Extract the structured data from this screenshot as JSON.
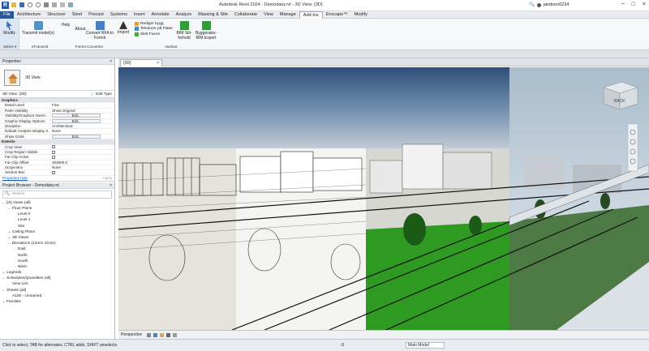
{
  "window": {
    "title": "Autodesk Revit 2024 - Demodata.rvt - 3D View: {3D}",
    "user": "jandson0234"
  },
  "menu": [
    "File",
    "Architecture",
    "Structure",
    "Steel",
    "Precast",
    "Systems",
    "Insert",
    "Annotate",
    "Analyze",
    "Massing & Site",
    "Collaborate",
    "View",
    "Manage",
    "Add-Ins",
    "Enscape™",
    "Modify"
  ],
  "ribbon": {
    "modify": "Modify",
    "select": "Select ▾",
    "transmit": "Transmit model(s)",
    "transmit_group": "eTransmit",
    "help": "Help",
    "about": "About",
    "convert": "Convert RFA to Formit",
    "formit_group": "FormIt Converter",
    "import": "Import",
    "rediger": "Rediger bygg",
    "teksturer": "Teksturer på Flater",
    "slett": "Slett Faces",
    "bim_forhold": "BIM Stil-forhold",
    "byggesaks": "Byggesaks-BIM Export",
    "norkart_group": "Norkart"
  },
  "properties": {
    "header": "Properties",
    "type_name": "3D View",
    "selector": "3D View: {3D}",
    "edit_type": "Edit Type",
    "rows": [
      {
        "k": "Graphics",
        "v": "",
        "cat": true
      },
      {
        "k": "Detail Level",
        "v": "Fine"
      },
      {
        "k": "Parts Visibility",
        "v": "Show Original"
      },
      {
        "k": "Visibility/Graphics Overri...",
        "v": "Edit...",
        "btn": true
      },
      {
        "k": "Graphic Display Options",
        "v": "Edit...",
        "btn": true
      },
      {
        "k": "Discipline",
        "v": "Architectural"
      },
      {
        "k": "Default Analysis Display S...",
        "v": "None"
      },
      {
        "k": "Show Grids",
        "v": "Edit...",
        "btn": true
      },
      {
        "k": "Extents",
        "v": "",
        "cat": true
      },
      {
        "k": "Crop View",
        "v": "",
        "cb": true
      },
      {
        "k": "Crop Region Visible",
        "v": "",
        "cb": true
      },
      {
        "k": "Far Clip Active",
        "v": "",
        "cb": true
      },
      {
        "k": "Far Clip Offset",
        "v": "304800.0"
      },
      {
        "k": "Scope Box",
        "v": "None"
      },
      {
        "k": "Section Box",
        "v": "",
        "cb": true
      }
    ],
    "help_link": "Properties help",
    "apply": "Apply"
  },
  "browser": {
    "header": "Project Browser - Demodata.rvt",
    "search": "Search",
    "items": [
      {
        "t": "[O] Views (all)",
        "lvl": 0,
        "tg": "−"
      },
      {
        "t": "Floor Plans",
        "lvl": 1,
        "tg": "−"
      },
      {
        "t": "Level 0",
        "lvl": 2,
        "tg": ""
      },
      {
        "t": "Level 1",
        "lvl": 2,
        "tg": ""
      },
      {
        "t": "Site",
        "lvl": 2,
        "tg": ""
      },
      {
        "t": "Ceiling Plans",
        "lvl": 1,
        "tg": "+"
      },
      {
        "t": "3D Views",
        "lvl": 1,
        "tg": "+"
      },
      {
        "t": "Elevations (12mm Circle)",
        "lvl": 1,
        "tg": "−"
      },
      {
        "t": "East",
        "lvl": 2,
        "tg": ""
      },
      {
        "t": "North",
        "lvl": 2,
        "tg": ""
      },
      {
        "t": "South",
        "lvl": 2,
        "tg": ""
      },
      {
        "t": "West",
        "lvl": 2,
        "tg": ""
      },
      {
        "t": "Legends",
        "lvl": 0,
        "tg": "+"
      },
      {
        "t": "Schedules/Quantities (all)",
        "lvl": 0,
        "tg": "−"
      },
      {
        "t": "View List",
        "lvl": 1,
        "tg": ""
      },
      {
        "t": "Sheets (all)",
        "lvl": 0,
        "tg": "−"
      },
      {
        "t": "A100 - Unnamed",
        "lvl": 1,
        "tg": ""
      },
      {
        "t": "Families",
        "lvl": 0,
        "tg": "+"
      }
    ]
  },
  "viewtab": "{3D}",
  "viewcube": "BACK",
  "viewbar_label": "Perspective",
  "status": {
    "text": "Click to select, TAB for alternates, CTRL adds, SHIFT unselects.",
    "model": "Main Model",
    "zero": ":0"
  },
  "colors": {
    "ribbon_bg": "#f7f8fa",
    "file_blue": "#2b5797",
    "sky_top": "#33557f",
    "sky_bottom": "#b8c3cc",
    "grass": "#2f9a22"
  }
}
